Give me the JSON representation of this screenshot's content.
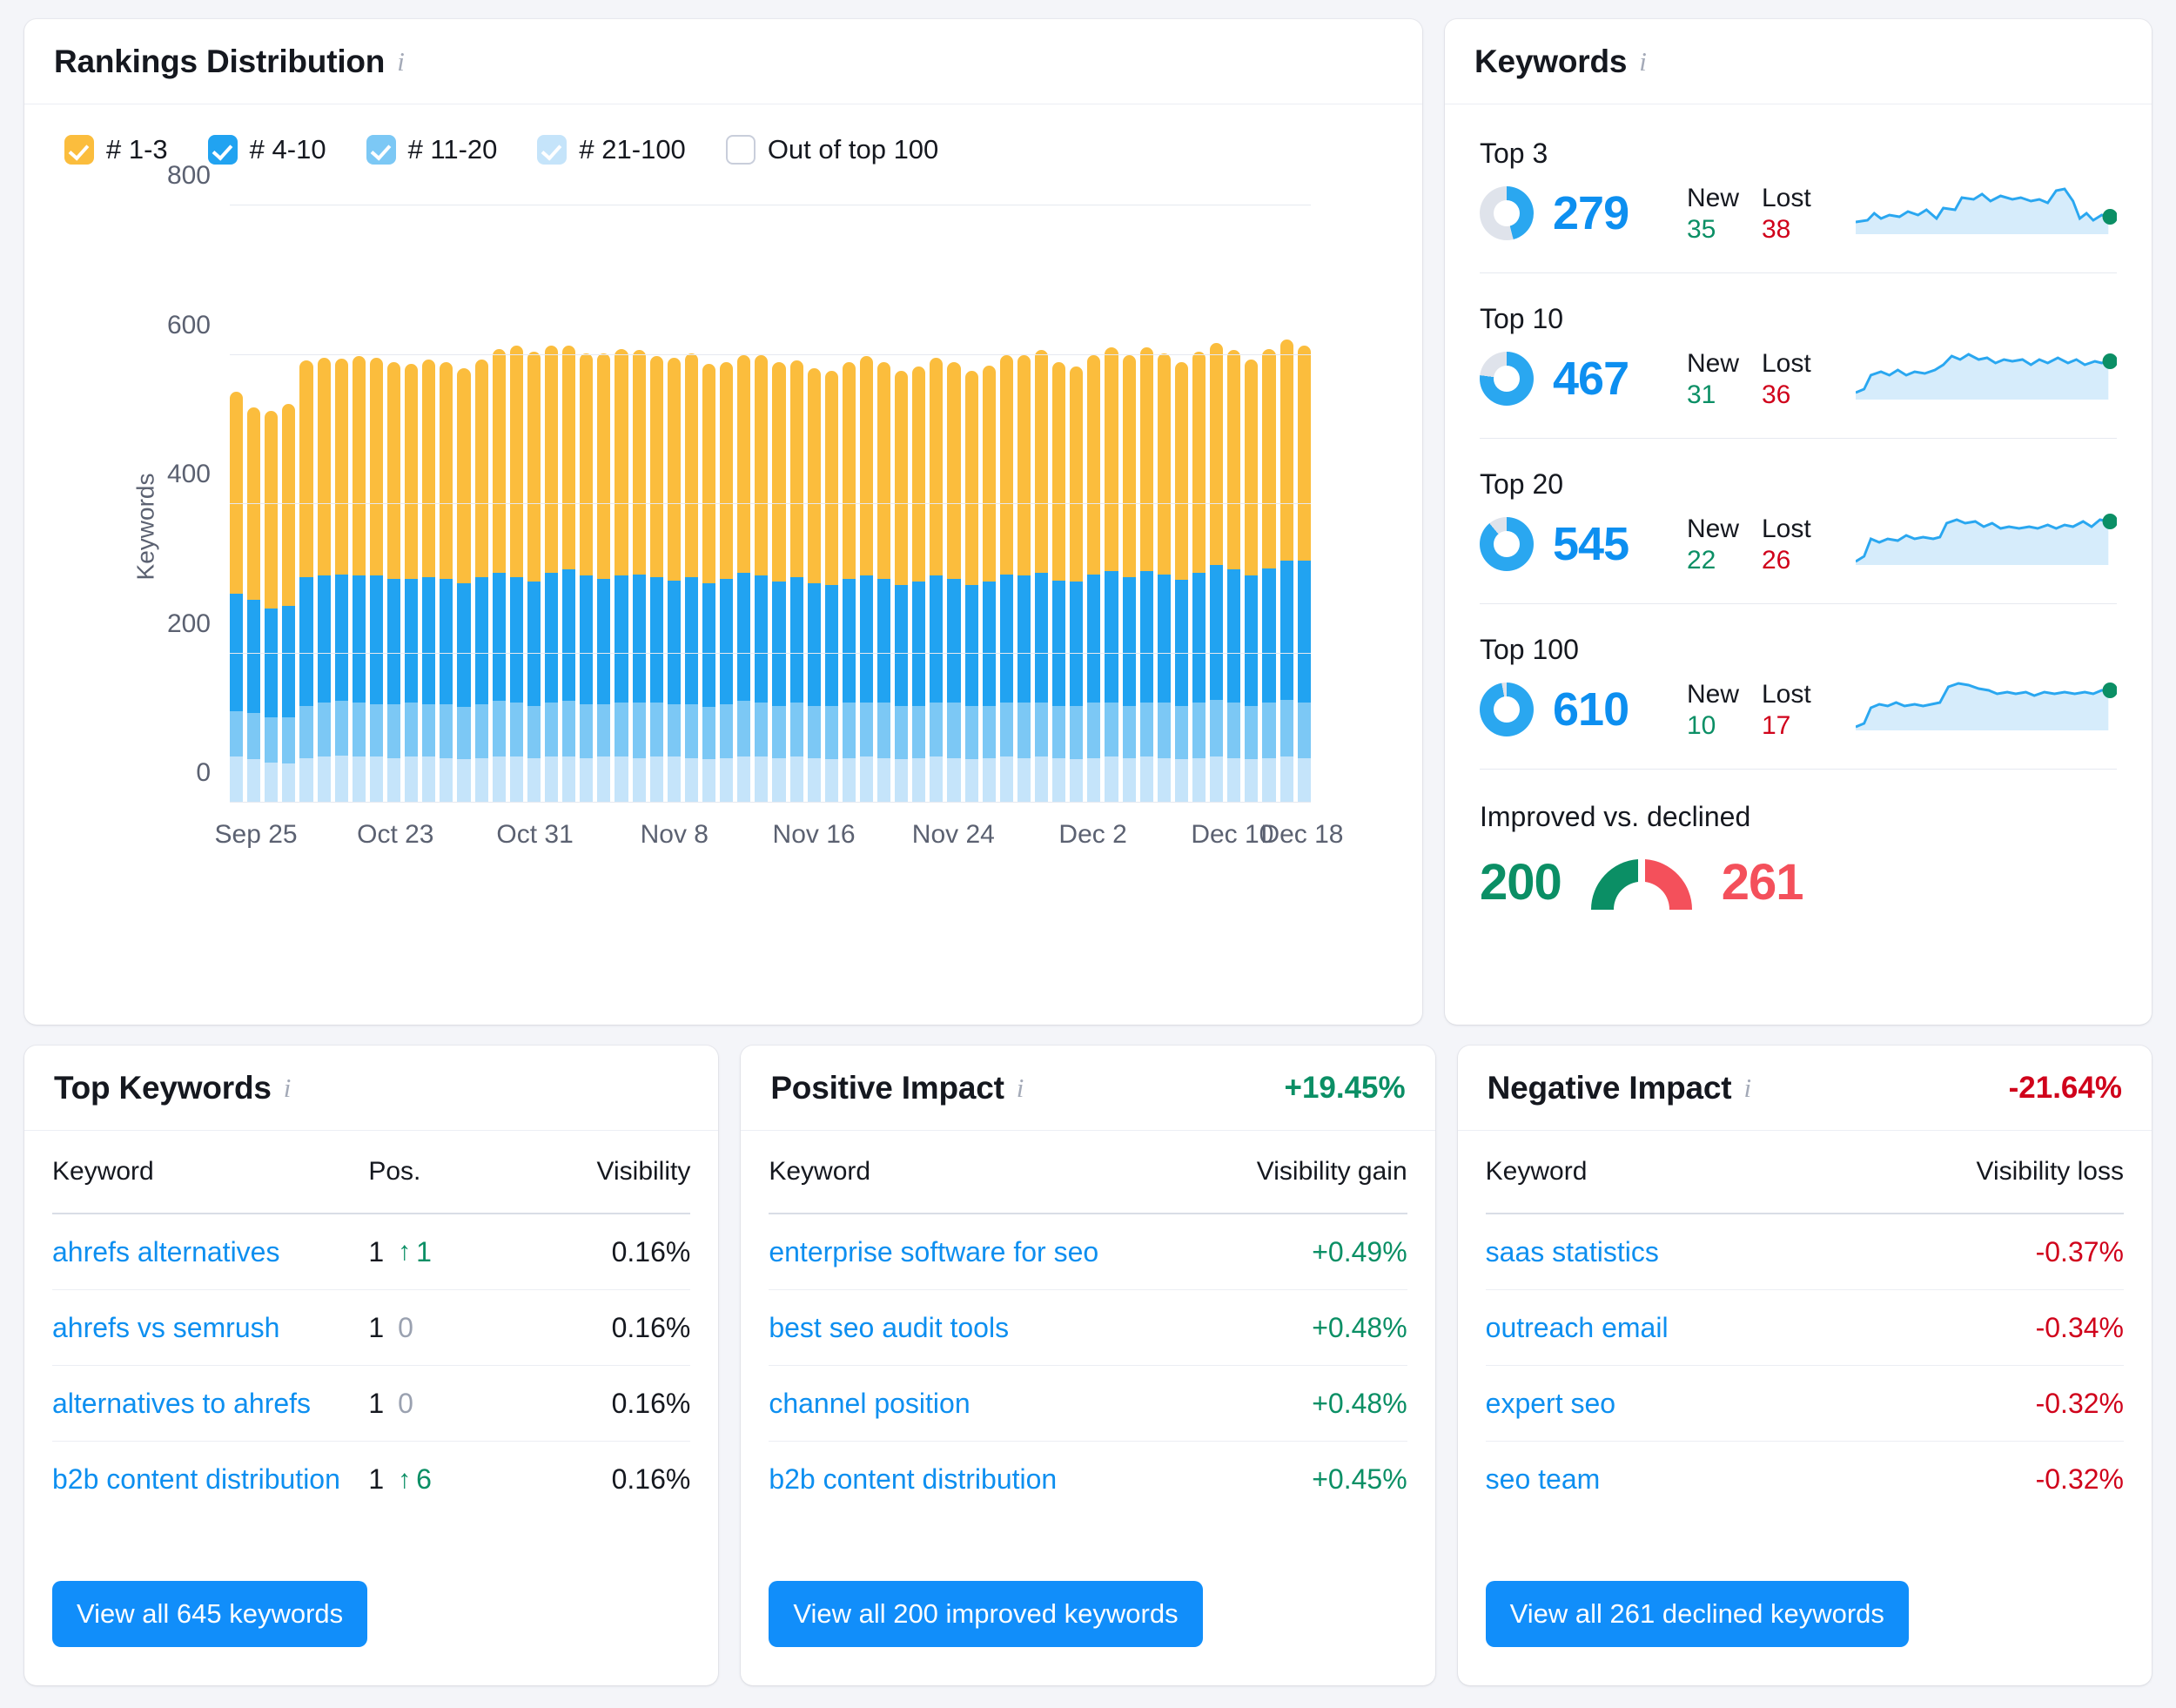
{
  "rankings": {
    "title": "Rankings Distribution",
    "info_icon": "info-icon",
    "legend": [
      {
        "label": "# 1-3",
        "color": "#fbbd3d",
        "checked": true
      },
      {
        "label": "# 4-10",
        "color": "#21a3f1",
        "checked": true
      },
      {
        "label": "# 11-20",
        "color": "#7cc8f5",
        "checked": true
      },
      {
        "label": "# 21-100",
        "color": "#c5e4fa",
        "checked": true
      },
      {
        "label": "Out of top 100",
        "color": "#ffffff",
        "checked": false
      }
    ]
  },
  "chart_data": {
    "type": "bar",
    "stacked": true,
    "title": "Rankings Distribution",
    "xlabel": "",
    "ylabel": "Keywords",
    "ylim": [
      0,
      800
    ],
    "yticks": [
      0,
      200,
      400,
      600,
      800
    ],
    "grid": true,
    "legend_position": "top",
    "xtick_labels": [
      "Sep 25",
      "Oct 23",
      "Oct 31",
      "Nov 8",
      "Nov 16",
      "Nov 24",
      "Dec 2",
      "Dec 10",
      "Dec 18"
    ],
    "xtick_indices": [
      1,
      9,
      17,
      25,
      33,
      41,
      49,
      57,
      61
    ],
    "series": [
      {
        "name": "# 21-100",
        "color": "#c5e4fa",
        "values": [
          62,
          58,
          54,
          52,
          60,
          62,
          63,
          62,
          62,
          60,
          62,
          62,
          60,
          58,
          60,
          62,
          62,
          60,
          62,
          62,
          60,
          62,
          62,
          60,
          62,
          62,
          60,
          58,
          60,
          62,
          62,
          60,
          62,
          60,
          58,
          60,
          62,
          60,
          58,
          60,
          62,
          60,
          58,
          60,
          62,
          60,
          62,
          60,
          58,
          60,
          62,
          60,
          62,
          60,
          58,
          60,
          62,
          60,
          58,
          60,
          62,
          60
        ]
      },
      {
        "name": "# 11-20",
        "color": "#7cc8f5",
        "values": [
          60,
          62,
          60,
          62,
          70,
          72,
          74,
          72,
          70,
          72,
          72,
          70,
          72,
          70,
          72,
          74,
          72,
          70,
          72,
          74,
          72,
          70,
          72,
          74,
          72,
          70,
          72,
          70,
          72,
          74,
          72,
          70,
          72,
          70,
          72,
          74,
          72,
          74,
          72,
          70,
          72,
          74,
          72,
          70,
          72,
          74,
          72,
          70,
          72,
          74,
          72,
          70,
          72,
          74,
          72,
          74,
          76,
          74,
          72,
          74,
          76,
          74
        ]
      },
      {
        "name": "# 4-10",
        "color": "#21a3f1",
        "values": [
          158,
          152,
          146,
          150,
          172,
          170,
          168,
          170,
          172,
          168,
          166,
          170,
          168,
          166,
          170,
          172,
          168,
          166,
          174,
          176,
          172,
          168,
          170,
          172,
          168,
          166,
          170,
          166,
          168,
          172,
          170,
          166,
          168,
          164,
          162,
          166,
          170,
          166,
          162,
          166,
          170,
          166,
          162,
          166,
          172,
          170,
          174,
          168,
          166,
          172,
          176,
          172,
          176,
          172,
          168,
          174,
          180,
          178,
          174,
          180,
          186,
          190
        ]
      },
      {
        "name": "# 1-3",
        "color": "#fbbd3d",
        "values": [
          270,
          258,
          265,
          270,
          290,
          292,
          290,
          294,
          292,
          290,
          288,
          292,
          290,
          288,
          292,
          300,
          310,
          308,
          304,
          300,
          298,
          302,
          304,
          300,
          296,
          298,
          300,
          294,
          290,
          292,
          296,
          294,
          290,
          288,
          286,
          290,
          294,
          290,
          286,
          288,
          292,
          290,
          286,
          290,
          294,
          296,
          298,
          292,
          288,
          294,
          300,
          298,
          300,
          296,
          292,
          296,
          298,
          294,
          290,
          294,
          296,
          288
        ]
      }
    ]
  },
  "keywords": {
    "title": "Keywords",
    "info_icon": "info-icon",
    "new_header": "New",
    "lost_header": "Lost",
    "rows": [
      {
        "name": "Top 3",
        "value": "279",
        "new": "35",
        "lost": "38",
        "fill_pct": 46
      },
      {
        "name": "Top 10",
        "value": "467",
        "new": "31",
        "lost": "36",
        "fill_pct": 77
      },
      {
        "name": "Top 20",
        "value": "545",
        "new": "22",
        "lost": "26",
        "fill_pct": 89
      },
      {
        "name": "Top 100",
        "value": "610",
        "new": "10",
        "lost": "17",
        "fill_pct": 97
      }
    ],
    "improved_declined": {
      "label": "Improved vs. declined",
      "improved": "200",
      "declined": "261",
      "improved_color": "#0b8f65",
      "declined_color": "#f4505b"
    }
  },
  "top_keywords": {
    "title": "Top Keywords",
    "info_icon": "info-icon",
    "headers": {
      "keyword": "Keyword",
      "pos": "Pos.",
      "visibility": "Visibility"
    },
    "rows": [
      {
        "keyword": "ahrefs alternatives",
        "pos": "1",
        "delta": "1",
        "dir": "up",
        "visibility": "0.16%"
      },
      {
        "keyword": "ahrefs vs semrush",
        "pos": "1",
        "delta": "0",
        "dir": "zero",
        "visibility": "0.16%"
      },
      {
        "keyword": "alternatives to ahrefs",
        "pos": "1",
        "delta": "0",
        "dir": "zero",
        "visibility": "0.16%"
      },
      {
        "keyword": "b2b content distribution",
        "pos": "1",
        "delta": "6",
        "dir": "up",
        "visibility": "0.16%"
      }
    ],
    "button": "View all 645 keywords"
  },
  "positive_impact": {
    "title": "Positive Impact",
    "info_icon": "info-icon",
    "metric": "+19.45%",
    "headers": {
      "keyword": "Keyword",
      "value": "Visibility gain"
    },
    "rows": [
      {
        "keyword": "enterprise software for seo",
        "value": "+0.49%"
      },
      {
        "keyword": "best seo audit tools",
        "value": "+0.48%"
      },
      {
        "keyword": "channel position",
        "value": "+0.48%"
      },
      {
        "keyword": "b2b content distribution",
        "value": "+0.45%"
      }
    ],
    "button": "View all 200 improved keywords"
  },
  "negative_impact": {
    "title": "Negative Impact",
    "info_icon": "info-icon",
    "metric": "-21.64%",
    "headers": {
      "keyword": "Keyword",
      "value": "Visibility loss"
    },
    "rows": [
      {
        "keyword": "saas statistics",
        "value": "-0.37%"
      },
      {
        "keyword": "outreach email",
        "value": "-0.34%"
      },
      {
        "keyword": "expert seo",
        "value": "-0.32%"
      },
      {
        "keyword": "seo team",
        "value": "-0.32%"
      }
    ],
    "button": "View all 261 declined keywords"
  }
}
